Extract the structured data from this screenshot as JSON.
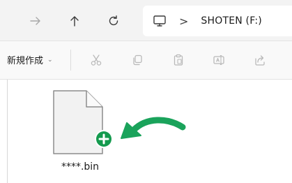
{
  "navigation": {
    "forward_icon": "arrow-right-icon",
    "up_icon": "arrow-up-icon",
    "refresh_icon": "refresh-icon"
  },
  "address_bar": {
    "location_icon": "computer-icon",
    "separator": ">",
    "drive_label": "SHOTEN (F:)"
  },
  "command_bar": {
    "new_label": "新規作成",
    "new_caret": "⌄",
    "tools": [
      "cut-icon",
      "copy-icon",
      "paste-icon",
      "rename-icon",
      "share-icon"
    ]
  },
  "files": [
    {
      "name": "****.bin",
      "icon": "file-icon",
      "badge": "add-plus-icon"
    }
  ],
  "annotation": {
    "arrow_color": "#1aa35b",
    "badge_color": "#149a4e"
  }
}
